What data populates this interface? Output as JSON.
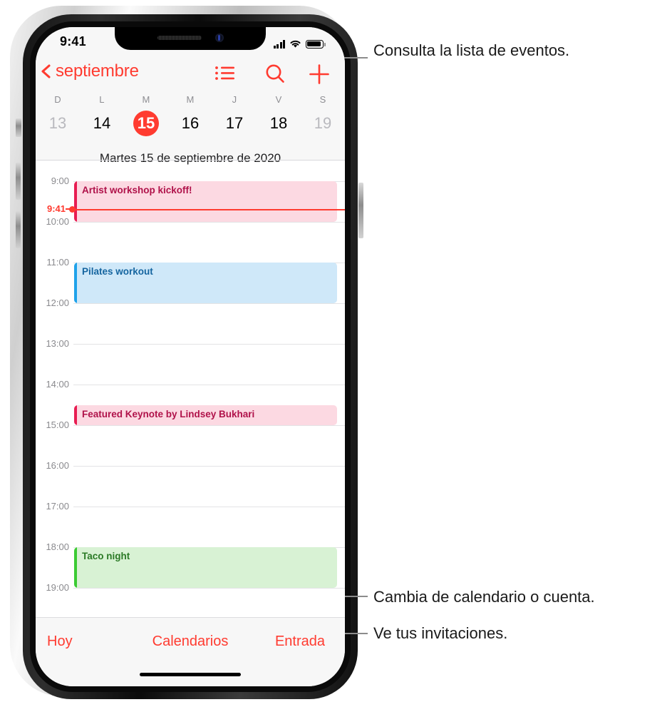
{
  "device": {
    "status_bar": {
      "time": "9:41",
      "icons": [
        "cellular-signal-icon",
        "wifi-icon",
        "battery-icon"
      ]
    },
    "home_indicator": "home-indicator"
  },
  "nav_bar": {
    "back_label": "septiembre",
    "back_icon": "chevron-left-icon",
    "actions": [
      {
        "name": "list-view-icon",
        "label": "Lista de eventos"
      },
      {
        "name": "search-icon",
        "label": "Buscar"
      },
      {
        "name": "add-event-icon",
        "label": "Añadir evento"
      }
    ]
  },
  "week_strip": {
    "weekday_labels": [
      "D",
      "L",
      "M",
      "M",
      "J",
      "V",
      "S"
    ],
    "days": [
      {
        "num": "13",
        "state": "dim"
      },
      {
        "num": "14",
        "state": "normal"
      },
      {
        "num": "15",
        "state": "selected"
      },
      {
        "num": "16",
        "state": "normal"
      },
      {
        "num": "17",
        "state": "normal"
      },
      {
        "num": "18",
        "state": "normal"
      },
      {
        "num": "19",
        "state": "dim"
      }
    ],
    "full_date": "Martes  15 de septiembre de 2020"
  },
  "timeline": {
    "hours": [
      "9:00",
      "10:00",
      "11:00",
      "12:00",
      "13:00",
      "14:00",
      "15:00",
      "16:00",
      "17:00",
      "18:00",
      "19:00"
    ],
    "now": {
      "label": "9:41",
      "time_decimal": 9.683
    },
    "events": [
      {
        "title": "Artist workshop kickoff!",
        "start": "9:00",
        "end": "10:00",
        "color": "pink",
        "accent": "#e81d52"
      },
      {
        "title": "Pilates workout",
        "start": "11:00",
        "end": "12:00",
        "color": "blue",
        "accent": "#1fa2ea"
      },
      {
        "title": "Featured Keynote by Lindsey Bukhari",
        "start": "14:30",
        "end": "15:00",
        "color": "pink",
        "accent": "#e81d52"
      },
      {
        "title": "Taco night",
        "start": "18:00",
        "end": "19:00",
        "color": "green",
        "accent": "#3bcb33"
      }
    ]
  },
  "bottom_toolbar": {
    "today": "Hoy",
    "calendars": "Calendarios",
    "inbox": "Entrada"
  },
  "callouts": {
    "list_view": "Consulta la lista de eventos.",
    "calendars": "Cambia de calendario o cuenta.",
    "inbox": "Ve tus invitaciones."
  },
  "colors": {
    "accent_red": "#ff3b30",
    "screen_bg": "#ffffff",
    "chrome_bg": "#f7f7f7",
    "grid_line": "#e3e3e5",
    "muted_text": "#8e8e93"
  }
}
